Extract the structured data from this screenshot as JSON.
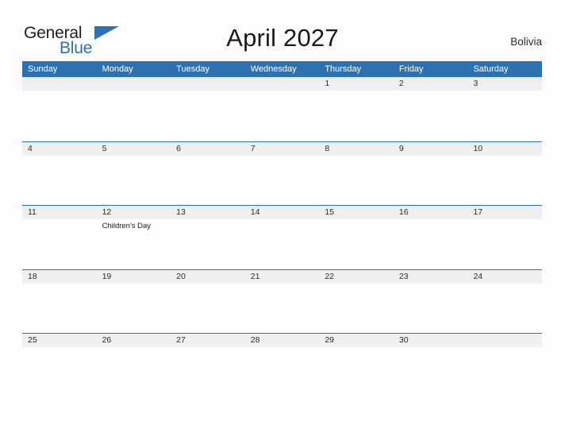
{
  "brand": {
    "name_part1": "General",
    "name_part2": "Blue",
    "flag_icon": "triangle-flag-icon",
    "color_dark": "#231f20",
    "color_blue": "#2b72b8"
  },
  "header": {
    "title": "April 2027",
    "locale": "Bolivia"
  },
  "calendar": {
    "header_bg": "#2e71b1",
    "band_bg": "#efefef",
    "weekdays": [
      "Sunday",
      "Monday",
      "Tuesday",
      "Wednesday",
      "Thursday",
      "Friday",
      "Saturday"
    ],
    "weeks": [
      [
        {
          "date": "",
          "events": []
        },
        {
          "date": "",
          "events": []
        },
        {
          "date": "",
          "events": []
        },
        {
          "date": "",
          "events": []
        },
        {
          "date": "1",
          "events": []
        },
        {
          "date": "2",
          "events": []
        },
        {
          "date": "3",
          "events": []
        }
      ],
      [
        {
          "date": "4",
          "events": []
        },
        {
          "date": "5",
          "events": []
        },
        {
          "date": "6",
          "events": []
        },
        {
          "date": "7",
          "events": []
        },
        {
          "date": "8",
          "events": []
        },
        {
          "date": "9",
          "events": []
        },
        {
          "date": "10",
          "events": []
        }
      ],
      [
        {
          "date": "11",
          "events": []
        },
        {
          "date": "12",
          "events": [
            "Children's Day"
          ]
        },
        {
          "date": "13",
          "events": []
        },
        {
          "date": "14",
          "events": []
        },
        {
          "date": "15",
          "events": []
        },
        {
          "date": "16",
          "events": []
        },
        {
          "date": "17",
          "events": []
        }
      ],
      [
        {
          "date": "18",
          "events": []
        },
        {
          "date": "19",
          "events": []
        },
        {
          "date": "20",
          "events": []
        },
        {
          "date": "21",
          "events": []
        },
        {
          "date": "22",
          "events": []
        },
        {
          "date": "23",
          "events": []
        },
        {
          "date": "24",
          "events": []
        }
      ],
      [
        {
          "date": "25",
          "events": []
        },
        {
          "date": "26",
          "events": []
        },
        {
          "date": "27",
          "events": []
        },
        {
          "date": "28",
          "events": []
        },
        {
          "date": "29",
          "events": []
        },
        {
          "date": "30",
          "events": []
        },
        {
          "date": "",
          "events": []
        }
      ]
    ]
  }
}
